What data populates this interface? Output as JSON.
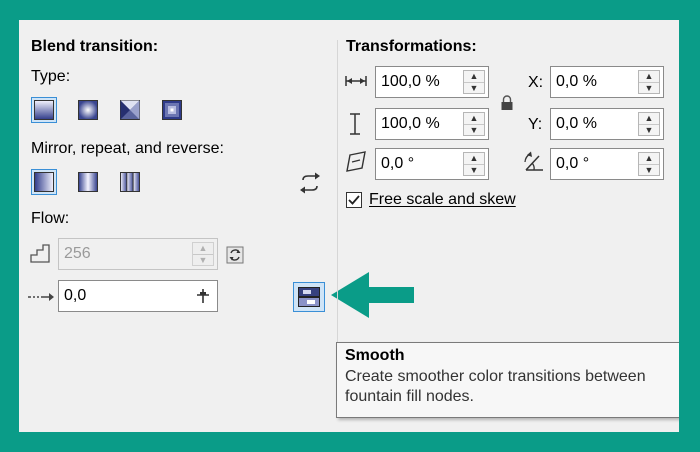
{
  "blend": {
    "heading": "Blend transition:",
    "type_label": "Type:",
    "mirror_label": "Mirror, repeat, and reverse:",
    "flow_label": "Flow:",
    "steps_value": "256",
    "accel_value": "0,0"
  },
  "transform": {
    "heading": "Transformations:",
    "width_value": "100,0 %",
    "height_value": "100,0 %",
    "skew_value": "0,0 °",
    "x_label": "X:",
    "x_value": "0,0 %",
    "y_label": "Y:",
    "y_value": "0,0 %",
    "rotate_value": "0,0 °",
    "free_scale_label": "Free scale and skew"
  },
  "tooltip": {
    "title": "Smooth",
    "description_line1": "Create smoother color transitions between",
    "description_line2": "fountain fill nodes."
  },
  "colors": {
    "frame": "#0a9c88",
    "arrow": "#0a9c88",
    "selection": "#3a8fd6"
  }
}
